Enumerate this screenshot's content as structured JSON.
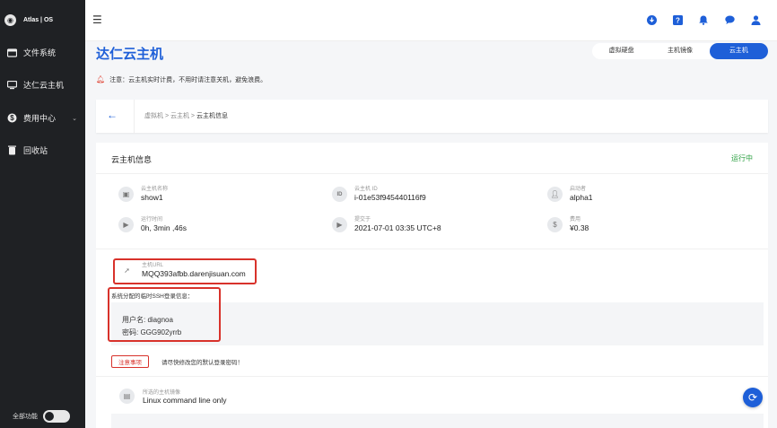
{
  "sidebar": {
    "brand": "Atlas | OS",
    "items": [
      {
        "label": "文件系统",
        "icon": "folder-icon"
      },
      {
        "label": "达仁云主机",
        "icon": "monitor-icon"
      },
      {
        "label": "费用中心",
        "icon": "dollar-icon"
      },
      {
        "label": "回收站",
        "icon": "trash-icon"
      }
    ],
    "toggle_label": "全部功能"
  },
  "header": {
    "icons": [
      "download-icon",
      "help-icon",
      "bell-icon",
      "chat-icon",
      "user-icon"
    ]
  },
  "page": {
    "title": "达仁云主机",
    "tabs": [
      {
        "label": "虚拟硬盘"
      },
      {
        "label": "主机镜像"
      },
      {
        "label": "云主机"
      }
    ],
    "notice": "注意：云主机实时计费，不用时请注意关机，避免浪费。",
    "breadcrumb": {
      "part1": "虚拟机",
      "part2": "云主机",
      "part3": "云主机信息"
    }
  },
  "card": {
    "title": "云主机信息",
    "status": "运行中",
    "fields": {
      "name": {
        "label": "云主机名称",
        "value": "show1"
      },
      "id": {
        "label": "云主机 ID",
        "value": "i-01e53f945440116f9"
      },
      "launcher": {
        "label": "启动者",
        "value": "alpha1"
      },
      "runtime": {
        "label": "运行时间",
        "value": "0h, 3min ,46s"
      },
      "submitted": {
        "label": "提交于",
        "value": "2021-07-01 03:35 UTC+8"
      },
      "cost": {
        "label": "费用",
        "value": "¥0.38"
      }
    },
    "host_url": {
      "label": "主机URL",
      "value": "MQQ393afbb.darenjisuan.com"
    },
    "ssh": {
      "intro": "系统分配的临时SSH登录信息：",
      "username": "用户名: diagnoa",
      "password": "密码: GGG902yrrb"
    },
    "note_button": "注意事项",
    "note_tip": "请尽快修改您的默认登录密码！",
    "image": {
      "label": "所选的主机镜像",
      "value": "Linux command line only"
    }
  },
  "colors": {
    "accent": "#1e5fd8",
    "sidebar": "#1f2124",
    "status_running": "#2ea043",
    "highlight": "#d8322b"
  }
}
